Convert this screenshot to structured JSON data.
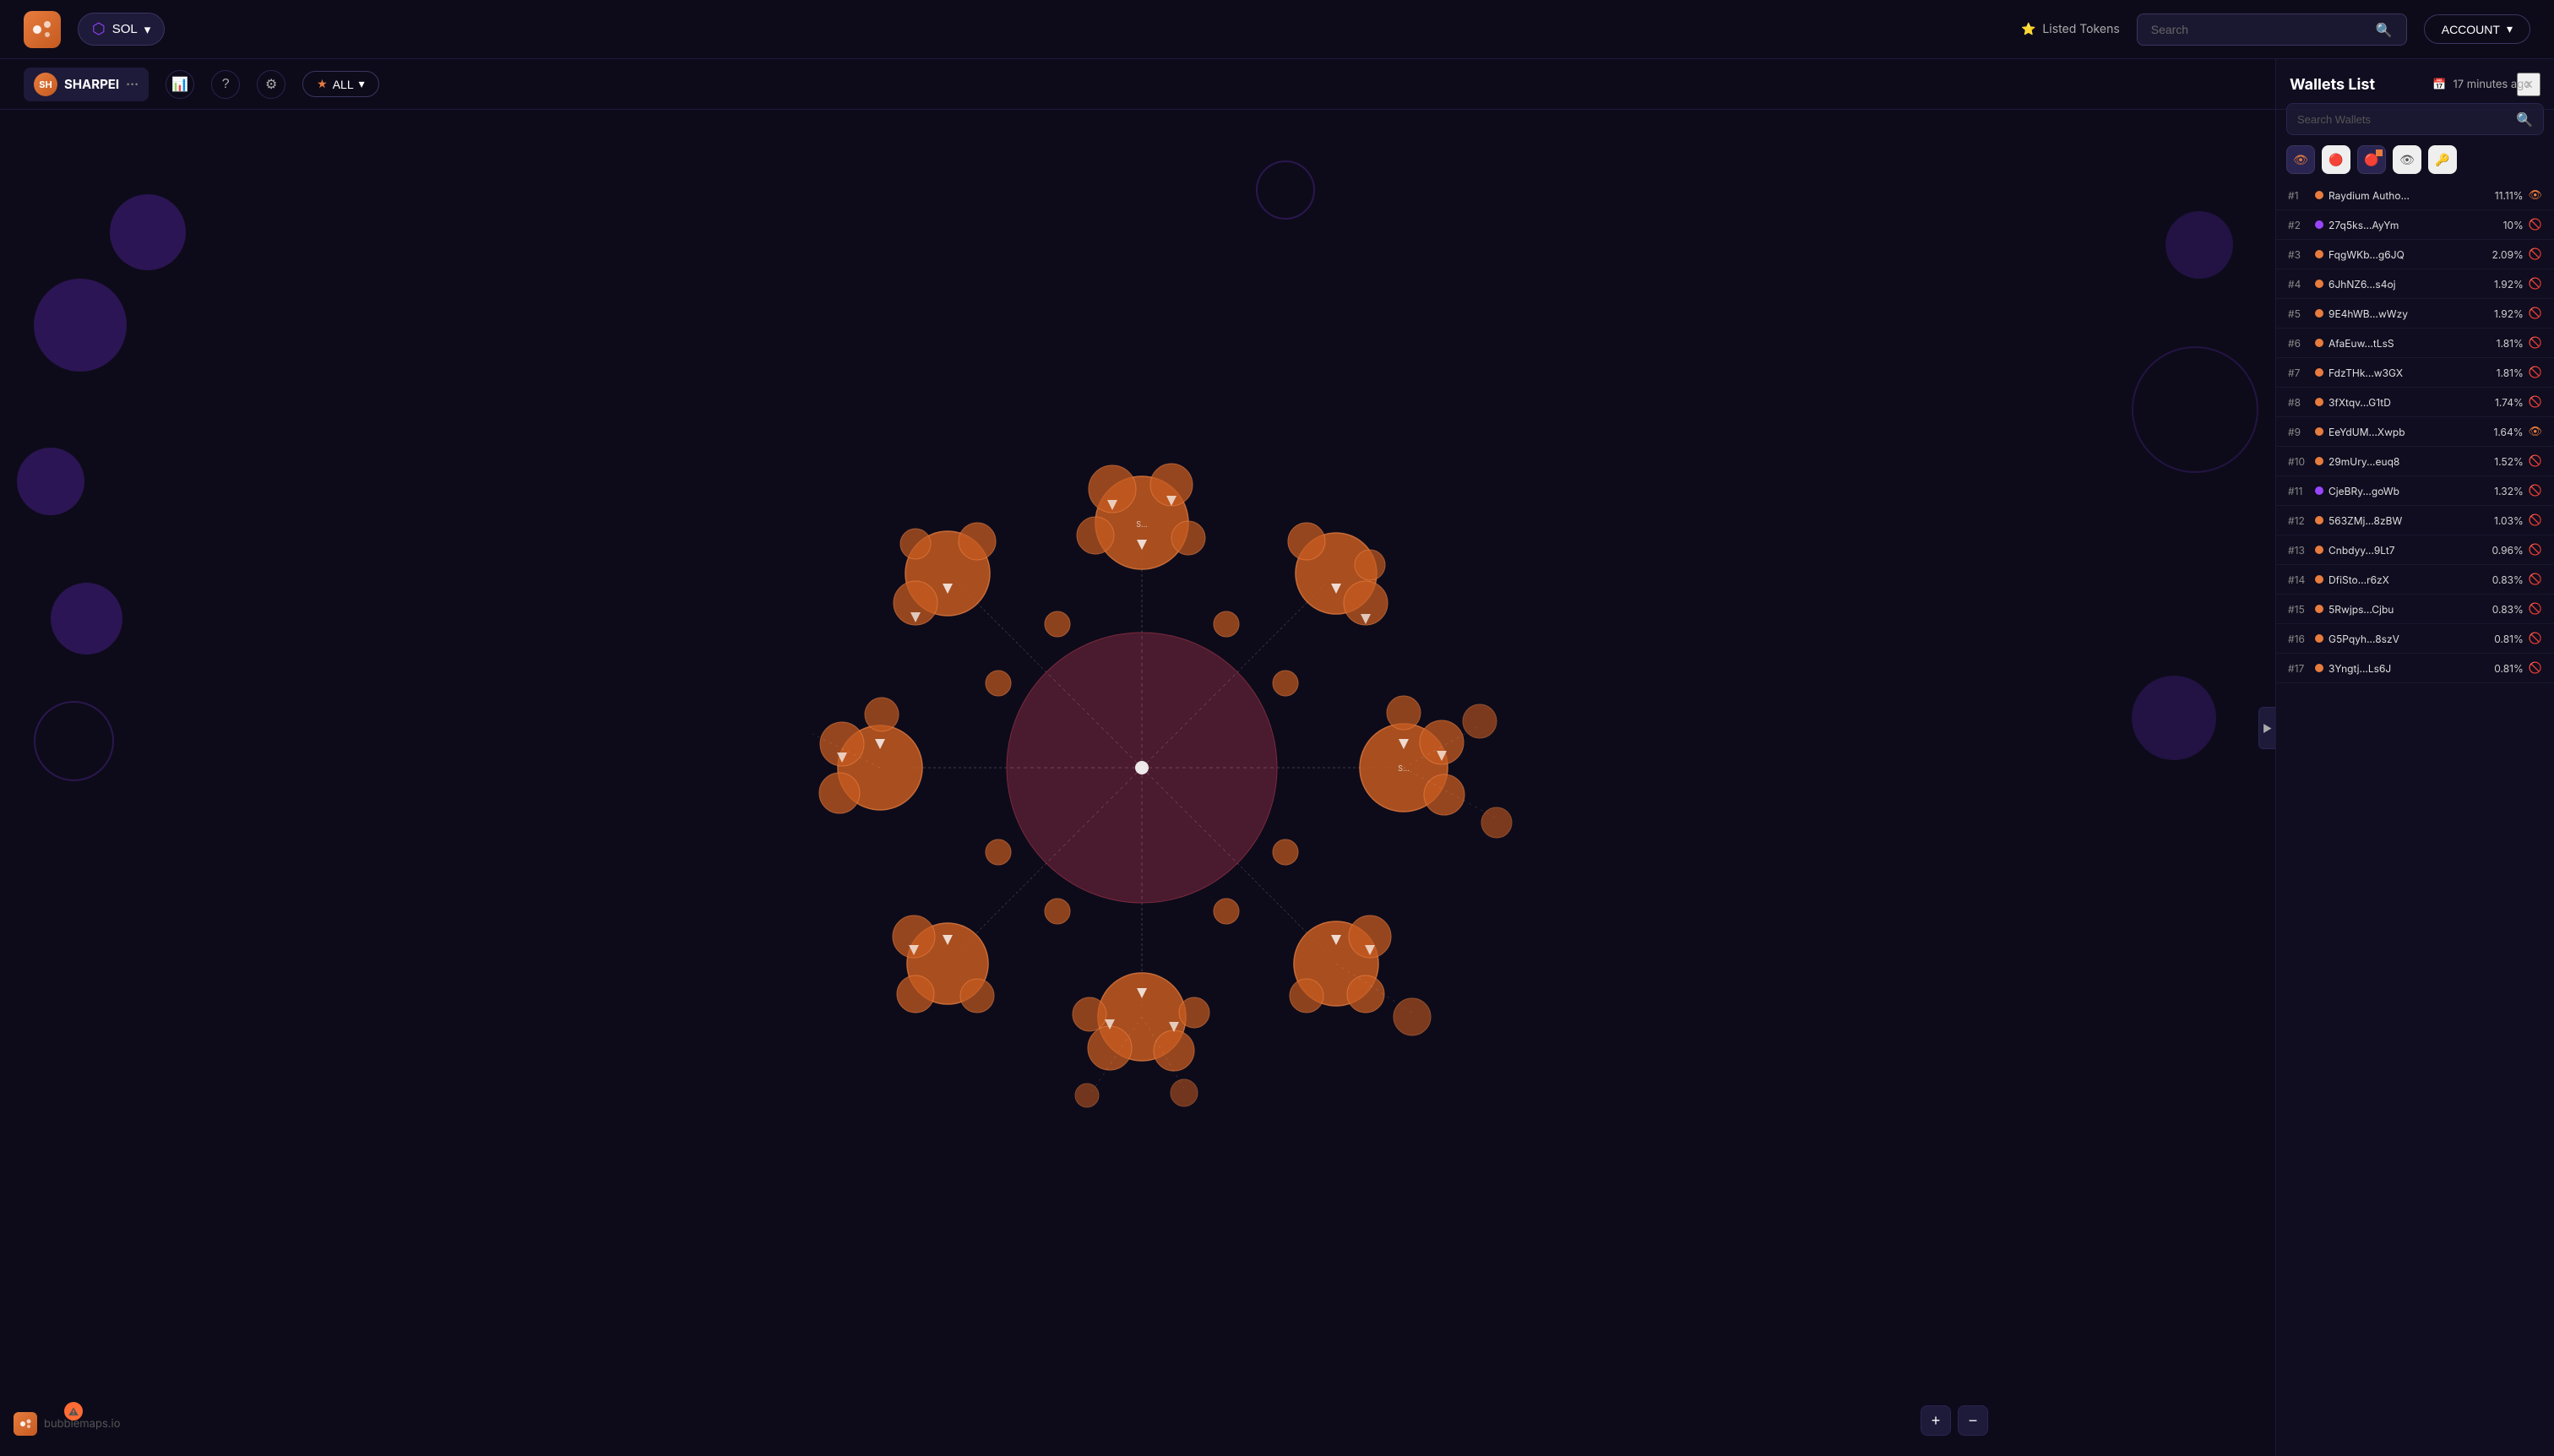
{
  "app": {
    "name": "bubblemaps.io",
    "logo_text": "M"
  },
  "topnav": {
    "chain_label": "SOL",
    "chain_icon": "≡",
    "listed_tokens_label": "Listed Tokens",
    "search_placeholder": "Search",
    "account_label": "ACCOUNT"
  },
  "subbar": {
    "user_initials": "SH",
    "token_name": "SHARPEI",
    "token_dots": "···",
    "filter_label": "ALL",
    "timestamp": "17 minutes ago"
  },
  "wallets": {
    "title": "Wallets List",
    "search_placeholder": "Search Wallets",
    "close_icon": "×",
    "filters": [
      {
        "icon": "👁",
        "active": true
      },
      {
        "icon": "🔴",
        "active": false
      },
      {
        "icon": "🔴",
        "active": true
      },
      {
        "icon": "👁",
        "active": false
      },
      {
        "icon": "🔑",
        "active": false
      }
    ],
    "items": [
      {
        "rank": "#1",
        "dot": "orange",
        "name": "Raydium Autho...",
        "pct": "11.11%",
        "visible": true
      },
      {
        "rank": "#2",
        "dot": "purple",
        "name": "27q5ks...AyYm",
        "pct": "10%",
        "visible": false
      },
      {
        "rank": "#3",
        "dot": "orange",
        "name": "FqgWKb...g6JQ",
        "pct": "2.09%",
        "visible": false
      },
      {
        "rank": "#4",
        "dot": "orange",
        "name": "6JhNZ6...s4oj",
        "pct": "1.92%",
        "visible": false
      },
      {
        "rank": "#5",
        "dot": "orange",
        "name": "9E4hWB...wWzy",
        "pct": "1.92%",
        "visible": false
      },
      {
        "rank": "#6",
        "dot": "orange",
        "name": "AfaEuw...tLsS",
        "pct": "1.81%",
        "visible": false
      },
      {
        "rank": "#7",
        "dot": "orange",
        "name": "FdzTHk...w3GX",
        "pct": "1.81%",
        "visible": false
      },
      {
        "rank": "#8",
        "dot": "orange",
        "name": "3fXtqv...G1tD",
        "pct": "1.74%",
        "visible": false
      },
      {
        "rank": "#9",
        "dot": "orange",
        "name": "EeYdUM...Xwpb",
        "pct": "1.64%",
        "visible": true
      },
      {
        "rank": "#10",
        "dot": "orange",
        "name": "29mUry...euq8",
        "pct": "1.52%",
        "visible": false
      },
      {
        "rank": "#11",
        "dot": "purple",
        "name": "CjeBRy...goWb",
        "pct": "1.32%",
        "visible": false
      },
      {
        "rank": "#12",
        "dot": "orange",
        "name": "563ZMj...8zBW",
        "pct": "1.03%",
        "visible": false
      },
      {
        "rank": "#13",
        "dot": "orange",
        "name": "Cnbdyy...9Lt7",
        "pct": "0.96%",
        "visible": false
      },
      {
        "rank": "#14",
        "dot": "orange",
        "name": "DfiSto...r6zX",
        "pct": "0.83%",
        "visible": false
      },
      {
        "rank": "#15",
        "dot": "orange",
        "name": "5Rwjps...Cjbu",
        "pct": "0.83%",
        "visible": false
      },
      {
        "rank": "#16",
        "dot": "orange",
        "name": "G5Pqyh...8szV",
        "pct": "0.81%",
        "visible": false
      },
      {
        "rank": "#17",
        "dot": "orange",
        "name": "3Yngtj...Ls6J",
        "pct": "0.81%",
        "visible": false
      }
    ]
  },
  "map_controls": {
    "zoom_in": "+",
    "zoom_out": "−"
  },
  "watermark": {
    "label": "bubblemaps.io",
    "icon": "M"
  }
}
